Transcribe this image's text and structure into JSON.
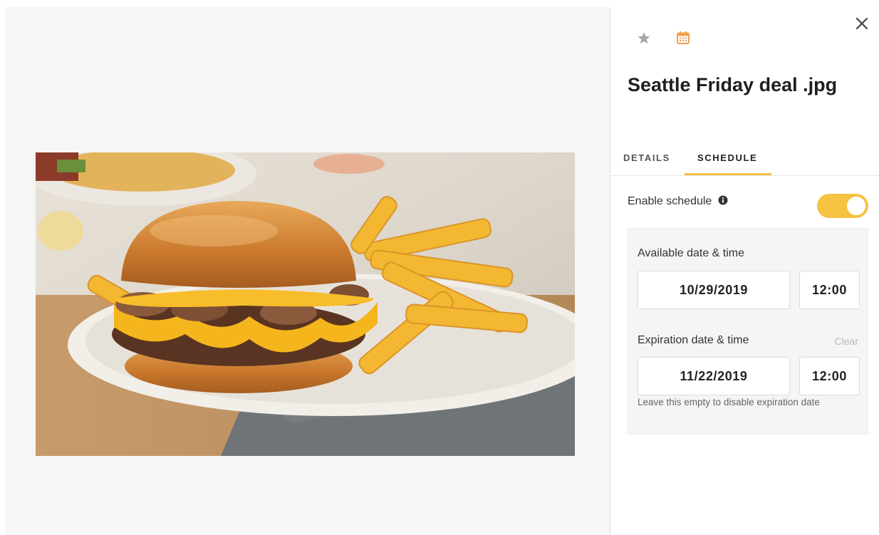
{
  "file": {
    "title": "Seattle Friday deal .jpg"
  },
  "tabs": {
    "details": "DETAILS",
    "schedule": "SCHEDULE"
  },
  "schedule": {
    "enable_label": "Enable schedule",
    "enabled": true,
    "available_label": "Available date & time",
    "available_date": "10/29/2019",
    "available_time": "12:00",
    "expiration_label": "Expiration date & time",
    "clear_label": "Clear",
    "expiration_date": "11/22/2019",
    "expiration_time": "12:00",
    "hint": "Leave this empty to disable expiration date"
  },
  "icons": {
    "close": "close-icon",
    "favorite": "star-icon",
    "schedule": "calendar-icon",
    "info": "info-icon"
  },
  "colors": {
    "accent": "#f5c242",
    "calendar_icon": "#f0a04b",
    "star_icon": "#a8a8a8"
  }
}
